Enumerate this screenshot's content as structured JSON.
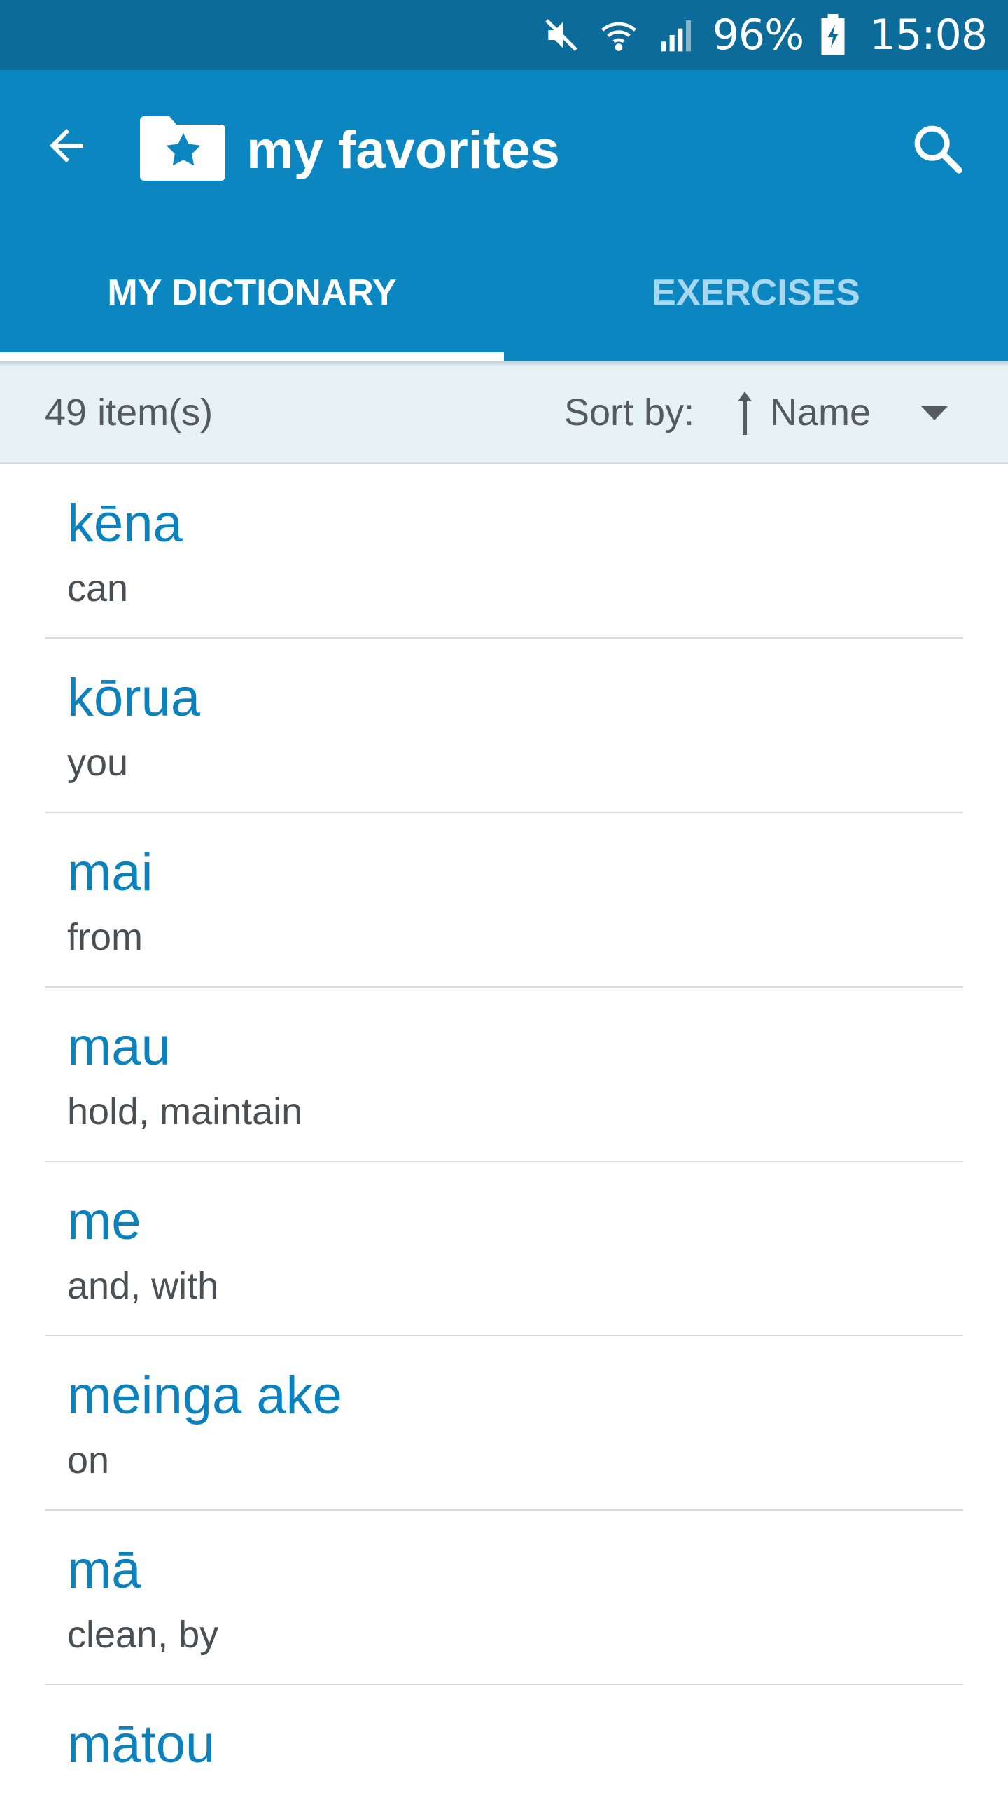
{
  "status_bar": {
    "battery_percent": "96%",
    "time": "15:08",
    "icons": [
      "mute-icon",
      "wifi-icon",
      "signal-icon",
      "battery-charging-icon"
    ]
  },
  "app_bar": {
    "title": "my favorites",
    "back_icon": "arrow-back-icon",
    "folder_icon": "folder-star-icon",
    "search_icon": "search-icon"
  },
  "tabs": [
    {
      "label": "MY DICTIONARY",
      "selected": true
    },
    {
      "label": "EXERCISES",
      "selected": false
    }
  ],
  "sort_bar": {
    "item_count": "49 item(s)",
    "sort_label": "Sort by:",
    "sort_value": "Name",
    "sort_direction_icon": "sort-ascending-icon",
    "dropdown_icon": "dropdown-arrow-icon"
  },
  "words": [
    {
      "word": "kēna",
      "meaning": "can"
    },
    {
      "word": "kōrua",
      "meaning": "you"
    },
    {
      "word": "mai",
      "meaning": "from"
    },
    {
      "word": "mau",
      "meaning": "hold, maintain"
    },
    {
      "word": "me",
      "meaning": "and, with"
    },
    {
      "word": "meinga ake",
      "meaning": "on"
    },
    {
      "word": "mā",
      "meaning": "clean, by"
    },
    {
      "word": "mātou",
      "meaning": ""
    }
  ],
  "colors": {
    "status_bar": "#0c6b98",
    "app_bar": "#0c86c0",
    "word_text": "#0b82bd",
    "sort_bar_bg": "#e6f1f6"
  }
}
